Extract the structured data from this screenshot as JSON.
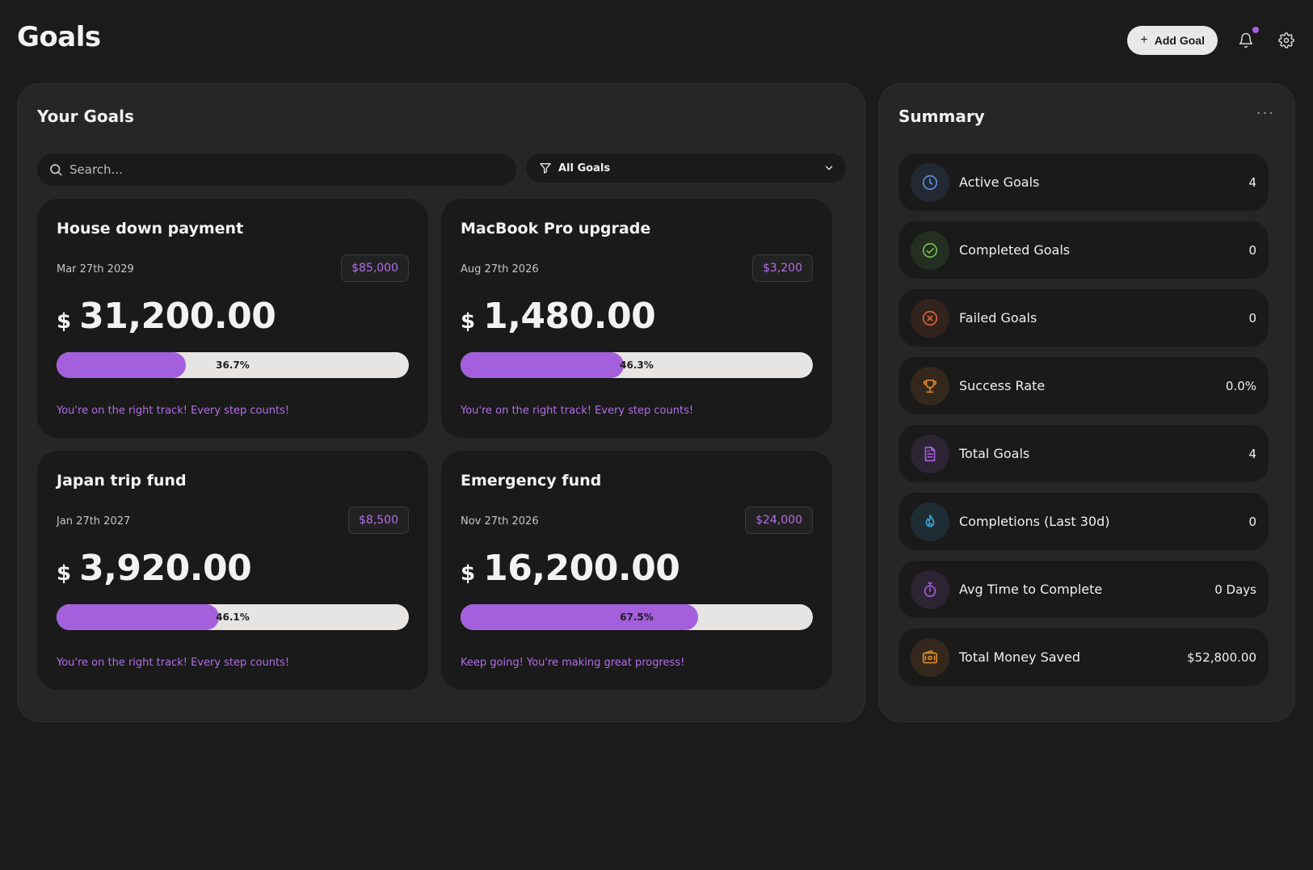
{
  "header": {
    "title": "Goals",
    "add_goal_label": "Add Goal"
  },
  "goals_panel": {
    "title": "Your Goals",
    "search_placeholder": "Search...",
    "filter_label": "All Goals",
    "cards": [
      {
        "name": "House down payment",
        "date": "Mar 27th 2029",
        "target": "$85,000",
        "currency": "$",
        "amount": "31,200.00",
        "progress": 36.7,
        "progress_label": "36.7%",
        "message": "You're on the right track! Every step counts!"
      },
      {
        "name": "MacBook Pro upgrade",
        "date": "Aug 27th 2026",
        "target": "$3,200",
        "currency": "$",
        "amount": "1,480.00",
        "progress": 46.3,
        "progress_label": "46.3%",
        "message": "You're on the right track! Every step counts!"
      },
      {
        "name": "Japan trip fund",
        "date": "Jan 27th 2027",
        "target": "$8,500",
        "currency": "$",
        "amount": "3,920.00",
        "progress": 46.1,
        "progress_label": "46.1%",
        "message": "You're on the right track! Every step counts!"
      },
      {
        "name": "Emergency fund",
        "date": "Nov 27th 2026",
        "target": "$24,000",
        "currency": "$",
        "amount": "16,200.00",
        "progress": 67.5,
        "progress_label": "67.5%",
        "message": "Keep going! You're making great progress!"
      }
    ]
  },
  "summary": {
    "title": "Summary",
    "more_label": "···",
    "rows": [
      {
        "label": "Active Goals",
        "value": "4",
        "icon": "clock-icon",
        "color": "#5b8fd9"
      },
      {
        "label": "Completed Goals",
        "value": "0",
        "icon": "check-circle-icon",
        "color": "#6fbf55"
      },
      {
        "label": "Failed Goals",
        "value": "0",
        "icon": "x-circle-icon",
        "color": "#d9653b"
      },
      {
        "label": "Success Rate",
        "value": "0.0%",
        "icon": "trophy-icon",
        "color": "#e08a2a"
      },
      {
        "label": "Total Goals",
        "value": "4",
        "icon": "document-icon",
        "color": "#a45fdc"
      },
      {
        "label": "Completions (Last 30d)",
        "value": "0",
        "icon": "flame-icon",
        "color": "#3aa6d9"
      },
      {
        "label": "Avg Time to Complete",
        "value": "0 Days",
        "icon": "stopwatch-icon",
        "color": "#a45fdc"
      },
      {
        "label": "Total Money Saved",
        "value": "$52,800.00",
        "icon": "wallet-icon",
        "color": "#e08a2a"
      }
    ]
  },
  "colors": {
    "accent": "#a45fdc",
    "background": "#1b1b1b",
    "panel": "#262626",
    "card": "#1a1a1a"
  }
}
